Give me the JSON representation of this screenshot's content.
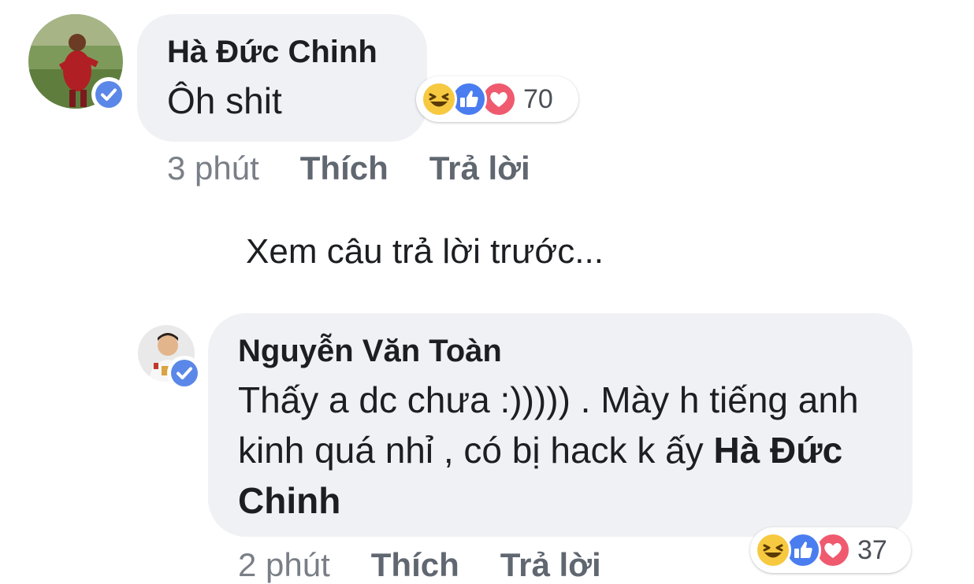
{
  "comment_1": {
    "author": "Hà Đức Chinh",
    "text": "Ôh shit",
    "reaction_count": "70",
    "time": "3 phút",
    "like_label": "Thích",
    "reply_label": "Trả lời",
    "reactions": [
      "haha-icon",
      "like-icon",
      "love-icon"
    ]
  },
  "previous_replies_label": "Xem câu trả lời trước...",
  "reply_1": {
    "author": "Nguyễn Văn Toàn",
    "text": "Thấy a dc chưa :))))) . Mày h tiếng anh kinh quá nhỉ , có bị hack k ấy",
    "mention": "Hà Đức Chinh",
    "reaction_count": "37",
    "time": "2 phút",
    "like_label": "Thích",
    "reply_label": "Trả lời",
    "reactions": [
      "haha-icon",
      "like-icon",
      "love-icon"
    ]
  },
  "colors": {
    "bubble_bg": "#f0f1f4",
    "verified_blue": "#5b88e8",
    "haha": "#f7c940",
    "like": "#4a7df0",
    "love": "#ef5a6f",
    "meta_text": "#606770"
  }
}
